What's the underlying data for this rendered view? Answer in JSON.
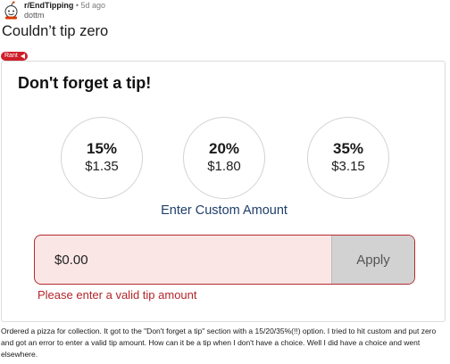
{
  "post": {
    "subreddit": "r/EndTipping",
    "separator": "•",
    "age": "5d ago",
    "author": "dottm",
    "title": "Couldn’t tip zero",
    "flair": "Rant",
    "body": "Ordered a pizza for collection. It got to the \"Don't forget a tip\" section with a 15/20/35%(!!) option. I tried to hit custom and put zero and got an error to enter a valid tip amount. How can it be a tip when I don't have a choice. Well I did have a choice and went elsewhere."
  },
  "screenshot": {
    "heading": "Don't forget a tip!",
    "tip_options": [
      {
        "percent": "15%",
        "amount": "$1.35"
      },
      {
        "percent": "20%",
        "amount": "$1.80"
      },
      {
        "percent": "35%",
        "amount": "$3.15"
      }
    ],
    "custom_amount_label": "Enter Custom Amount",
    "amount_input_value": "$0.00",
    "apply_label": "Apply",
    "error_message": "Please enter a valid tip amount",
    "colors": {
      "error": "#b3262b",
      "input_bg": "#fbe6e6",
      "link": "#1f3e6b",
      "flair": "#cf1f2a"
    }
  }
}
